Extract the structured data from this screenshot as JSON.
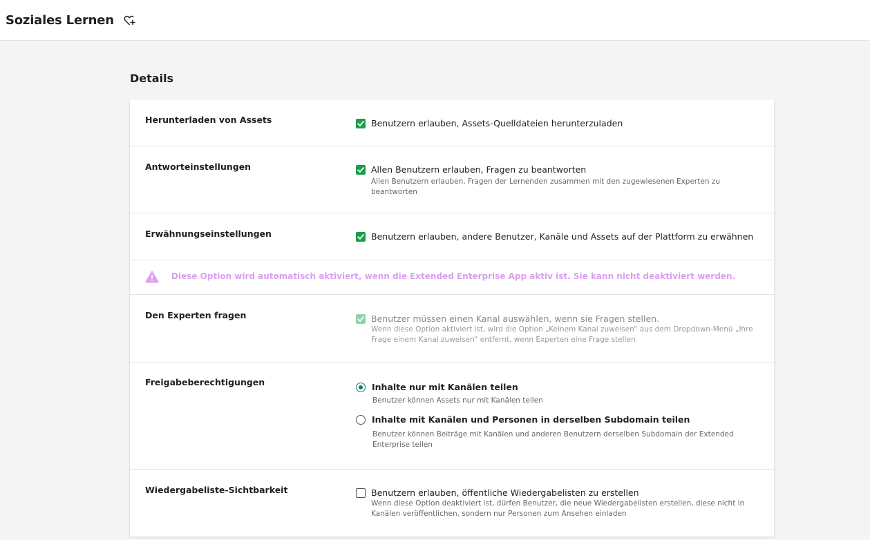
{
  "header": {
    "title": "Soziales Lernen",
    "favorite_icon": "heart-plus-icon"
  },
  "section": {
    "title": "Details"
  },
  "settings": {
    "download_assets": {
      "label": "Herunterladen von Assets",
      "option": "Benutzern erlauben, Assets-Quelldateien herunterzuladen",
      "checked": true
    },
    "answer_settings": {
      "label": "Antworteinstellungen",
      "option": "Allen Benutzern erlauben, Fragen zu beantworten",
      "description": "Allen Benutzern erlauben, Fragen der Lernenden zusammen mit den zugewiesenen Experten zu beantworten",
      "checked": true
    },
    "mention_settings": {
      "label": "Erwähnungseinstellungen",
      "option": "Benutzern erlauben, andere Benutzer, Kanäle und Assets auf der Plattform zu erwähnen",
      "checked": true
    },
    "notice": {
      "icon": "warning-triangle-icon",
      "text": "Diese Option wird automatisch aktiviert, wenn die Extended Enterprise App aktiv ist. Sie kann nicht deaktiviert werden.",
      "color": "#d9a0ef"
    },
    "ask_expert": {
      "label": "Den Experten fragen",
      "option": "Benutzer müssen einen Kanal auswählen, wenn sie Fragen stellen.",
      "description": "Wenn diese Option aktiviert ist, wird die Option „Keinem Kanal zuweisen“ aus dem Dropdown-Menü „Ihre Frage einem Kanal zuweisen“ entfernt, wenn Experten eine Frage stellen",
      "checked": true,
      "disabled": true
    },
    "sharing": {
      "label": "Freigabeberechtigungen",
      "options": [
        {
          "label": "Inhalte nur mit Kanälen teilen",
          "description": "Benutzer können Assets nur mit Kanälen teilen",
          "selected": true
        },
        {
          "label": "Inhalte mit Kanälen und Personen in derselben Subdomain teilen",
          "description": "Benutzer können Beiträge mit Kanälen und anderen Benutzern derselben Subdomain der Extended Enterprise teilen",
          "selected": false
        }
      ]
    },
    "playlist_visibility": {
      "label": "Wiedergabeliste-Sichtbarkeit",
      "option": "Benutzern erlauben, öffentliche Wiedergabelisten zu erstellen",
      "description": "Wenn diese Option deaktiviert ist, dürfen Benutzer, die neue Wiedergabelisten erstellen, diese nicht in Kanälen veröffentlichen, sondern nur Personen zum Ansehen einladen",
      "checked": false
    }
  },
  "colors": {
    "accent_green": "#1a9e4b",
    "radio_teal": "#0a7d6b",
    "page_background": "#f4f4f4"
  }
}
